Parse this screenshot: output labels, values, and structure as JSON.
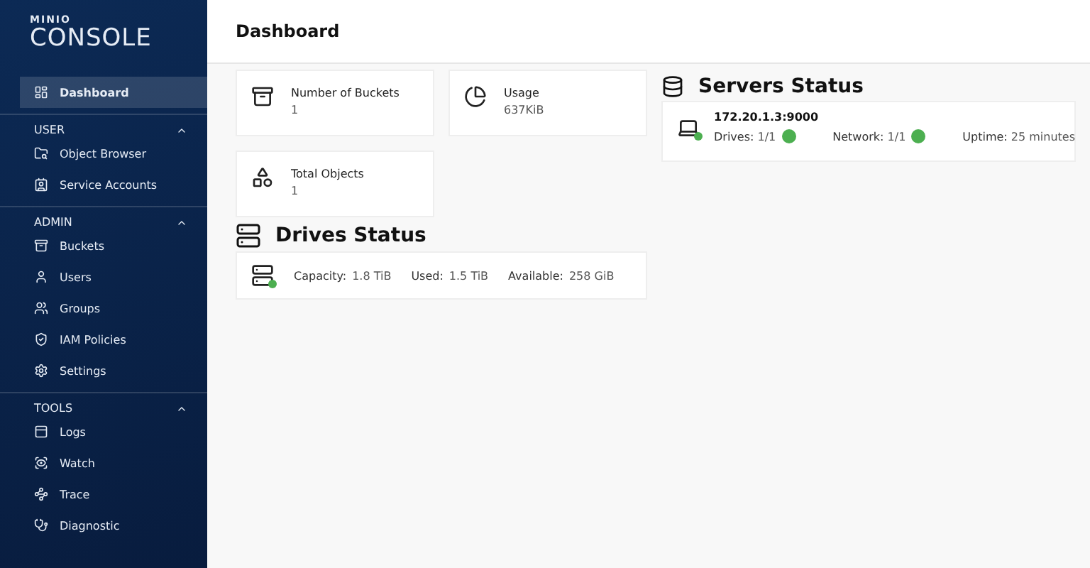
{
  "logo": {
    "brand": "MINIO",
    "product": "CONSOLE"
  },
  "header": {
    "title": "Dashboard"
  },
  "sidebar": {
    "top": [
      {
        "label": "Dashboard",
        "kind": "dashboard",
        "selected": true
      }
    ],
    "sections": [
      {
        "title": "USER",
        "expanded": true,
        "items": [
          {
            "label": "Object Browser",
            "kind": "browser",
            "selected": false
          },
          {
            "label": "Service Accounts",
            "kind": "accounts",
            "selected": false
          }
        ]
      },
      {
        "title": "ADMIN",
        "expanded": true,
        "items": [
          {
            "label": "Buckets",
            "kind": "bucket",
            "selected": false
          },
          {
            "label": "Users",
            "kind": "user",
            "selected": false
          },
          {
            "label": "Groups",
            "kind": "groups",
            "selected": false
          },
          {
            "label": "IAM Policies",
            "kind": "shield",
            "selected": false
          },
          {
            "label": "Settings",
            "kind": "settings",
            "selected": false
          }
        ]
      },
      {
        "title": "TOOLS",
        "expanded": true,
        "items": [
          {
            "label": "Logs",
            "kind": "logs",
            "selected": false
          },
          {
            "label": "Watch",
            "kind": "watch",
            "selected": false
          },
          {
            "label": "Trace",
            "kind": "trace",
            "selected": false
          },
          {
            "label": "Diagnostic",
            "kind": "diag",
            "selected": false
          }
        ]
      }
    ]
  },
  "stats": [
    {
      "label": "Number of Buckets",
      "value": "1",
      "kind": "bucket"
    },
    {
      "label": "Usage",
      "value": "637KiB",
      "kind": "pie"
    },
    {
      "label": "Total Objects",
      "value": "1",
      "kind": "objects"
    }
  ],
  "drives": {
    "title": "Drives Status",
    "online": true,
    "fields": [
      {
        "label": "Capacity:",
        "value": "1.8 TiB"
      },
      {
        "label": "Used:",
        "value": "1.5 TiB"
      },
      {
        "label": "Available:",
        "value": "258 GiB"
      }
    ]
  },
  "servers": {
    "title": "Servers Status",
    "items": [
      {
        "host": "172.20.1.3:9000",
        "online": true,
        "fields": [
          {
            "label": "Drives:",
            "value": "1/1",
            "ok": true
          },
          {
            "label": "Network:",
            "value": "1/1",
            "ok": true
          },
          {
            "label": "Uptime:",
            "value": "25 minutes"
          }
        ]
      }
    ]
  }
}
